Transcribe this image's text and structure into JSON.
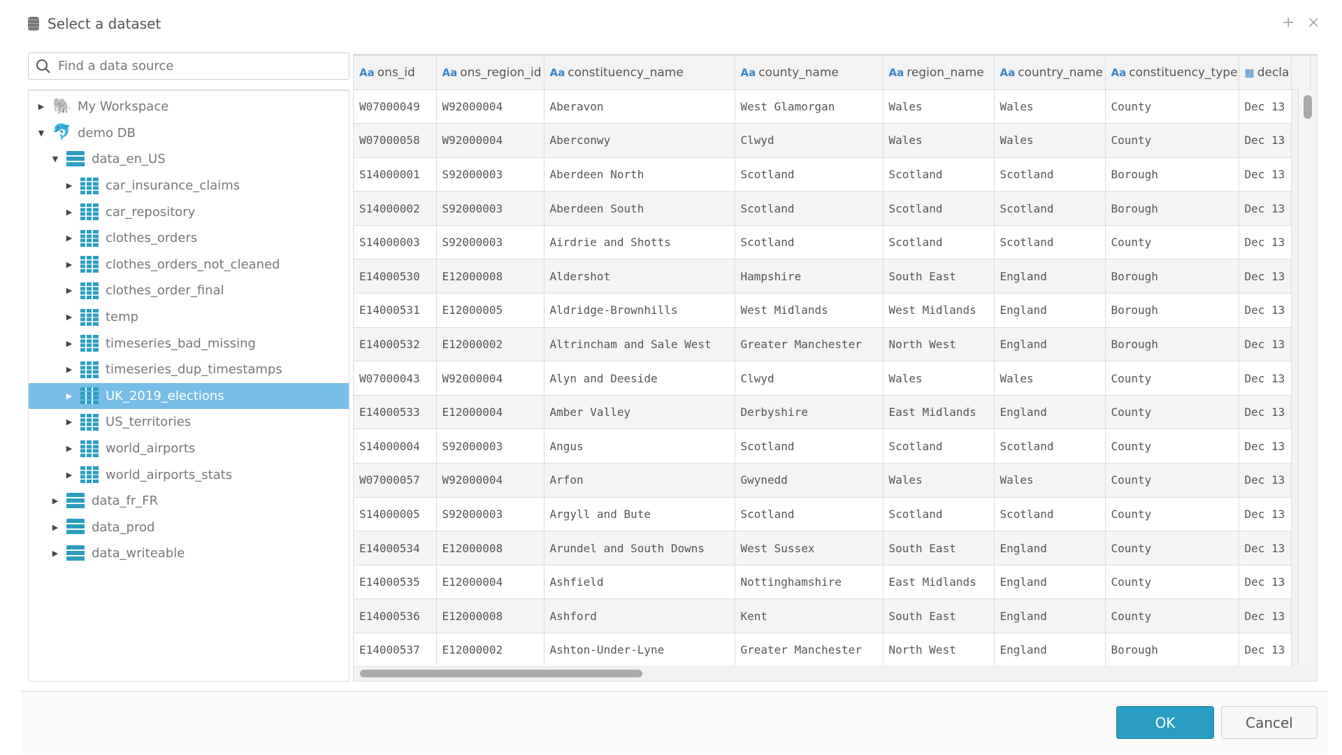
{
  "dialog": {
    "title": "Select a dataset",
    "icon": "database-icon",
    "add_label": "+",
    "close_label": "×"
  },
  "search": {
    "placeholder": "Find a data source",
    "value": ""
  },
  "tree": [
    {
      "label": "My Workspace",
      "level": 0,
      "type": "workspace",
      "expanded": false
    },
    {
      "label": "demo DB",
      "level": 0,
      "type": "database",
      "expanded": true
    },
    {
      "label": "data_en_US",
      "level": 1,
      "type": "schema",
      "expanded": true
    },
    {
      "label": "car_insurance_claims",
      "level": 2,
      "type": "table"
    },
    {
      "label": "car_repository",
      "level": 2,
      "type": "table"
    },
    {
      "label": "clothes_orders",
      "level": 2,
      "type": "table"
    },
    {
      "label": "clothes_orders_not_cleaned",
      "level": 2,
      "type": "table"
    },
    {
      "label": "clothes_order_final",
      "level": 2,
      "type": "table"
    },
    {
      "label": "temp",
      "level": 2,
      "type": "table"
    },
    {
      "label": "timeseries_bad_missing",
      "level": 2,
      "type": "table"
    },
    {
      "label": "timeseries_dup_timestamps",
      "level": 2,
      "type": "table"
    },
    {
      "label": "UK_2019_elections",
      "level": 2,
      "type": "table",
      "selected": true
    },
    {
      "label": "US_territories",
      "level": 2,
      "type": "table"
    },
    {
      "label": "world_airports",
      "level": 2,
      "type": "table"
    },
    {
      "label": "world_airports_stats",
      "level": 2,
      "type": "table"
    },
    {
      "label": "data_fr_FR",
      "level": 1,
      "type": "schema",
      "expanded": false
    },
    {
      "label": "data_prod",
      "level": 1,
      "type": "schema",
      "expanded": false
    },
    {
      "label": "data_writeable",
      "level": 1,
      "type": "schema",
      "expanded": false
    }
  ],
  "table": {
    "columns": [
      {
        "name": "ons_id",
        "type": "text"
      },
      {
        "name": "ons_region_id",
        "type": "text"
      },
      {
        "name": "constituency_name",
        "type": "text"
      },
      {
        "name": "county_name",
        "type": "text"
      },
      {
        "name": "region_name",
        "type": "text"
      },
      {
        "name": "country_name",
        "type": "text"
      },
      {
        "name": "constituency_type",
        "type": "text"
      },
      {
        "name": "decla",
        "type": "date"
      }
    ],
    "type_icon_text": "Aa",
    "rows": [
      [
        "W07000049",
        "W92000004",
        "Aberavon",
        "West Glamorgan",
        "Wales",
        "Wales",
        "County",
        "Dec 13"
      ],
      [
        "W07000058",
        "W92000004",
        "Aberconwy",
        "Clwyd",
        "Wales",
        "Wales",
        "County",
        "Dec 13"
      ],
      [
        "S14000001",
        "S92000003",
        "Aberdeen North",
        "Scotland",
        "Scotland",
        "Scotland",
        "Borough",
        "Dec 13"
      ],
      [
        "S14000002",
        "S92000003",
        "Aberdeen South",
        "Scotland",
        "Scotland",
        "Scotland",
        "Borough",
        "Dec 13"
      ],
      [
        "S14000003",
        "S92000003",
        "Airdrie and Shotts",
        "Scotland",
        "Scotland",
        "Scotland",
        "County",
        "Dec 13"
      ],
      [
        "E14000530",
        "E12000008",
        "Aldershot",
        "Hampshire",
        "South East",
        "England",
        "Borough",
        "Dec 13"
      ],
      [
        "E14000531",
        "E12000005",
        "Aldridge-Brownhills",
        "West Midlands",
        "West Midlands",
        "England",
        "Borough",
        "Dec 13"
      ],
      [
        "E14000532",
        "E12000002",
        "Altrincham and Sale West",
        "Greater Manchester",
        "North West",
        "England",
        "Borough",
        "Dec 13"
      ],
      [
        "W07000043",
        "W92000004",
        "Alyn and Deeside",
        "Clwyd",
        "Wales",
        "Wales",
        "County",
        "Dec 13"
      ],
      [
        "E14000533",
        "E12000004",
        "Amber Valley",
        "Derbyshire",
        "East Midlands",
        "England",
        "County",
        "Dec 13"
      ],
      [
        "S14000004",
        "S92000003",
        "Angus",
        "Scotland",
        "Scotland",
        "Scotland",
        "County",
        "Dec 13"
      ],
      [
        "W07000057",
        "W92000004",
        "Arfon",
        "Gwynedd",
        "Wales",
        "Wales",
        "County",
        "Dec 13"
      ],
      [
        "S14000005",
        "S92000003",
        "Argyll and Bute",
        "Scotland",
        "Scotland",
        "Scotland",
        "County",
        "Dec 13"
      ],
      [
        "E14000534",
        "E12000008",
        "Arundel and South Downs",
        "West Sussex",
        "South East",
        "England",
        "County",
        "Dec 13"
      ],
      [
        "E14000535",
        "E12000004",
        "Ashfield",
        "Nottinghamshire",
        "East Midlands",
        "England",
        "County",
        "Dec 13"
      ],
      [
        "E14000536",
        "E12000008",
        "Ashford",
        "Kent",
        "South East",
        "England",
        "County",
        "Dec 13"
      ],
      [
        "E14000537",
        "E12000002",
        "Ashton-Under-Lyne",
        "Greater Manchester",
        "North West",
        "England",
        "Borough",
        "Dec 13"
      ]
    ]
  },
  "buttons": {
    "ok": "OK",
    "cancel": "Cancel"
  },
  "colors": {
    "accent": "#2a9ec2",
    "selected": "#78bde8"
  }
}
